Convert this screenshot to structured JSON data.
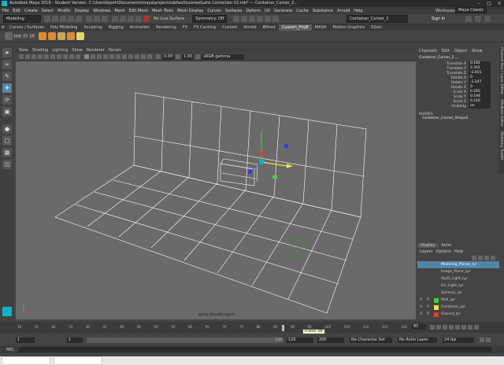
{
  "window": {
    "title": "Autodesk Maya 2019 - Student Version: C:\\Users\\kjoeh\\Documents\\maya\\projects\\default\\scenes\\Lens Correction V2.mb* --- Container_Corner_2..."
  },
  "menubar": {
    "items": [
      "File",
      "Edit",
      "Create",
      "Select",
      "Modify",
      "Display",
      "Windows",
      "Mesh",
      "Edit Mesh",
      "Mesh Tools",
      "Mesh Display",
      "Curves",
      "Surfaces",
      "Deform",
      "UV",
      "Generate",
      "Cache",
      "Substance",
      "Arnold",
      "Help"
    ],
    "workspace_label": "Workspace:",
    "workspace_value": "Maya Classic"
  },
  "statusline": {
    "mode": "Modeling",
    "live_surface": "No Live Surface",
    "symmetry": "Symmetry: Off",
    "object_field": "Container_Corner_2",
    "sign_in": "Sign In"
  },
  "shelf": {
    "tabs": [
      "Curves / Surfaces",
      "Poly Modeling",
      "Sculpting",
      "Rigging",
      "Animation",
      "Rendering",
      "FX",
      "FX Caching",
      "Custom",
      "Arnold",
      "Bifrost",
      "Custom_ProjE",
      "MASH",
      "Motion Graphics",
      "XGen"
    ],
    "active_tab": "Custom_ProjE",
    "icons": [
      "Hist",
      "FT",
      "CP"
    ]
  },
  "panel": {
    "menus": [
      "View",
      "Shading",
      "Lighting",
      "Show",
      "Renderer",
      "Panels"
    ],
    "exposure": "0.00",
    "gamma": "1.00",
    "color_space": "sRGB gamma",
    "camera_label": "persp (Invalid Layer)"
  },
  "channelbox": {
    "menus": [
      "Channels",
      "Edit",
      "Object",
      "Show"
    ],
    "object": "Container_Corner_2 ...",
    "attributes": [
      {
        "name": "Translate X",
        "value": "0.181"
      },
      {
        "name": "Translate Y",
        "value": "2.341"
      },
      {
        "name": "Translate Z",
        "value": "-2.655"
      },
      {
        "name": "Rotate X",
        "value": "0"
      },
      {
        "name": "Rotate Y",
        "value": "-1.147"
      },
      {
        "name": "Rotate Z",
        "value": "0"
      },
      {
        "name": "Scale X",
        "value": "0.205"
      },
      {
        "name": "Scale Y",
        "value": "0.194"
      },
      {
        "name": "Scale Z",
        "value": "0.216"
      },
      {
        "name": "Visibility",
        "value": "on"
      }
    ],
    "shapes_header": "SHAPES",
    "shape_name": "Container_Corner_Shape2"
  },
  "sidetabs": [
    "Channel Box / Layer Editor",
    "Attribute Editor",
    "Modeling Toolkit"
  ],
  "layers": {
    "tabs": [
      "Display",
      "Anim"
    ],
    "menus": [
      "Layers",
      "Options",
      "Help"
    ],
    "rows": [
      {
        "v": "",
        "p": "",
        "name": "Modeling_Planes_lyr",
        "color": "#5285a6",
        "selected": true
      },
      {
        "v": "",
        "p": "",
        "name": "Image_Plane_Lyr",
        "color": "",
        "selected": false
      },
      {
        "v": "",
        "p": "",
        "name": "SkyD_Light_Lyr",
        "color": "",
        "selected": false
      },
      {
        "v": "",
        "p": "",
        "name": "Dir_Light_Lyr",
        "color": "",
        "selected": false
      },
      {
        "v": "",
        "p": "",
        "name": "Spheres_Lyr",
        "color": "",
        "selected": false
      },
      {
        "v": "V",
        "p": "P",
        "name": "Wall_Lyr",
        "color": "#3bd43b",
        "selected": false
      },
      {
        "v": "V",
        "p": "P",
        "name": "Container_Lyr",
        "color": "#e6e63a",
        "selected": false
      },
      {
        "v": "V",
        "p": "P",
        "name": "Ground_lyr",
        "color": "#e23b3b",
        "selected": false
      }
    ]
  },
  "timeslider": {
    "ticks": [
      "10",
      "15",
      "20",
      "25",
      "30",
      "35",
      "40",
      "45",
      "50",
      "55",
      "60",
      "65",
      "70",
      "75",
      "80",
      "85",
      "90",
      "95",
      "100",
      "105",
      "110",
      "115",
      "120"
    ],
    "tooltip": "Frame: 84",
    "current_frame": "85"
  },
  "rangeslider": {
    "start": "1",
    "inner_start": "1",
    "range_label": "120",
    "inner_end": "120",
    "end": "200",
    "char_set": "No Character Set",
    "anim_layer": "No Anim Layer",
    "fps": "24 fps"
  },
  "cmdline": {
    "label": "MEL"
  },
  "colors": {
    "viewport_bg": "#6a6a6a",
    "selected_layer": "#5285a6",
    "active_tab": "#5d5d5d"
  }
}
